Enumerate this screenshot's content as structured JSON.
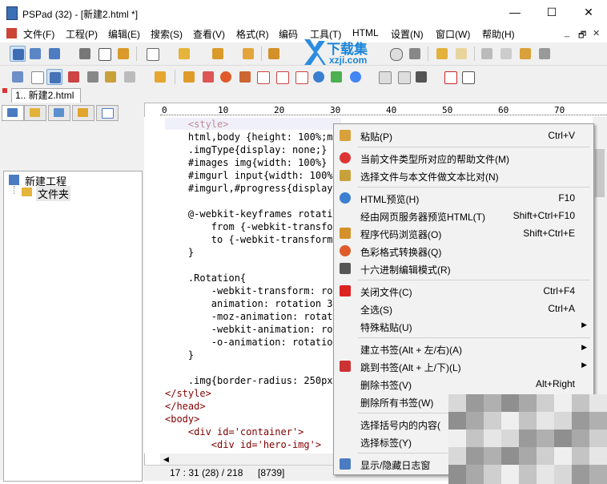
{
  "window": {
    "title": "PSPad (32) - [新建2.html *]",
    "minimize": "—",
    "maximize": "☐",
    "close": "✕"
  },
  "menu": {
    "items": [
      "文件(F)",
      "工程(P)",
      "编辑(E)",
      "搜索(S)",
      "查看(V)",
      "格式(R)",
      "编码",
      "工具(T)",
      "HTML",
      "设置(N)",
      "窗口(W)",
      "帮助(H)"
    ],
    "mdi_controls": [
      "_",
      "🗗",
      "✕"
    ]
  },
  "file_tab": {
    "label": "1.. 新建2.html"
  },
  "project_tree": {
    "root": "新建工程",
    "folder": "文件夹"
  },
  "ruler": {
    "marks": [
      "0",
      "10",
      "20",
      "30",
      "40",
      "50",
      "60",
      "70"
    ]
  },
  "editor": {
    "lines": [
      "    <style>",
      "    html,body {height: 100%;ma",
      "    .imgType{display: none;}",
      "    #images img{width: 100%}",
      "    #imgurl input{width: 100%}",
      "    #imgurl,#progress{display:",
      "",
      "    @-webkit-keyframes rotatio",
      "        from {-webkit-transfor",
      "        to {-webkit-transform:",
      "    }",
      "",
      "    .Rotation{",
      "        -webkit-transform: rot",
      "        animation: rotation 3s",
      "        -moz-animation: rotati",
      "        -webkit-animation: rot",
      "        -o-animation: rotation",
      "    }",
      "",
      "    .img{border-radius: 250px;",
      "</style>",
      "</head>",
      "<body>",
      "    <div id='container'>",
      "        <div id='hero-img'>"
    ]
  },
  "status": {
    "position": "17 : 31 (28) / 218",
    "size": "[8739]"
  },
  "context_menu": {
    "items": [
      {
        "label": "粘贴(P)",
        "shortcut": "Ctrl+V",
        "icon": "paste-icon"
      },
      {
        "label": "当前文件类型所对应的帮助文件(M)",
        "shortcut": "",
        "icon": "lifebuoy-icon"
      },
      {
        "label": "选择文件与本文件做文本比对(N)",
        "shortcut": "",
        "icon": "compare-icon"
      },
      {
        "label": "HTML预览(H)",
        "shortcut": "F10",
        "icon": "globe-icon"
      },
      {
        "label": "经由网页服务器预览HTML(T)",
        "shortcut": "Shift+Ctrl+F10",
        "icon": ""
      },
      {
        "label": "程序代码浏览器(O)",
        "shortcut": "Shift+Ctrl+E",
        "icon": "code-explorer-icon"
      },
      {
        "label": "色彩格式转换器(Q)",
        "shortcut": "",
        "icon": "color-wheel-icon"
      },
      {
        "label": "十六进制编辑模式(R)",
        "shortcut": "",
        "icon": "hex-icon"
      },
      {
        "label": "关闭文件(C)",
        "shortcut": "Ctrl+F4",
        "icon": "close-file-icon"
      },
      {
        "label": "全选(S)",
        "shortcut": "Ctrl+A",
        "icon": ""
      },
      {
        "label": "特殊粘贴(U)",
        "shortcut": "",
        "icon": ""
      },
      {
        "label": "建立书签(Alt + 左/右)(A)",
        "shortcut": "",
        "icon": ""
      },
      {
        "label": "跳到书签(Alt + 上/下)(L)",
        "shortcut": "",
        "icon": "bookmark-jump-icon"
      },
      {
        "label": "删除书签(V)",
        "shortcut": "Alt+Right",
        "icon": ""
      },
      {
        "label": "删除所有书签(W)",
        "shortcut": "",
        "icon": ""
      },
      {
        "label": "选择括号内的内容(",
        "shortcut": "",
        "icon": ""
      },
      {
        "label": "选择标签(Y)",
        "shortcut": "",
        "icon": ""
      },
      {
        "label": "显示/隐藏日志窗",
        "shortcut": "",
        "icon": "log-icon"
      }
    ]
  },
  "watermark": {
    "title": "下载集",
    "domain": "xzji.com"
  },
  "colors": {
    "toolbar_bg": "#f0f0f0",
    "menu_bg": "#f2f2f2",
    "tag": "#800000",
    "watermark": "#1a86d8"
  }
}
